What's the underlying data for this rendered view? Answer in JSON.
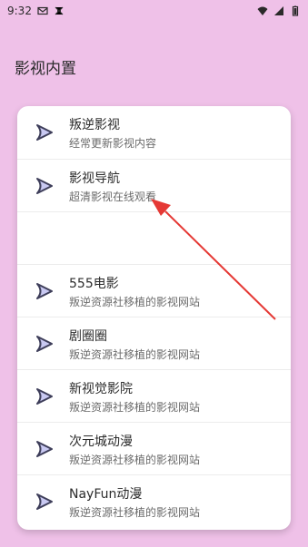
{
  "status": {
    "time": "9:32",
    "left_icons": [
      "mail-icon",
      "drone-icon"
    ],
    "right_icons": [
      "wifi-icon",
      "signal-icon",
      "battery-icon"
    ]
  },
  "app": {
    "title": "影视内置"
  },
  "list": {
    "items": [
      {
        "title": "叛逆影视",
        "subtitle": "经常更新影视内容",
        "icon": "play-arrow-icon"
      },
      {
        "title": "影视导航",
        "subtitle": "超清影视在线观看",
        "icon": "play-arrow-icon"
      },
      {
        "title": "",
        "subtitle": "",
        "icon": ""
      },
      {
        "title": "555电影",
        "subtitle": "叛逆资源社移植的影视网站",
        "icon": "play-arrow-icon"
      },
      {
        "title": "剧圈圈",
        "subtitle": "叛逆资源社移植的影视网站",
        "icon": "play-arrow-icon"
      },
      {
        "title": "新视觉影院",
        "subtitle": "叛逆资源社移植的影视网站",
        "icon": "play-arrow-icon"
      },
      {
        "title": "次元城动漫",
        "subtitle": "叛逆资源社移植的影视网站",
        "icon": "play-arrow-icon"
      },
      {
        "title": "NayFun动漫",
        "subtitle": "叛逆资源社移植的影视网站",
        "icon": "play-arrow-icon"
      }
    ]
  },
  "colors": {
    "background": "#efc1e8",
    "card": "#ffffff",
    "annotation_arrow": "#e53935"
  }
}
